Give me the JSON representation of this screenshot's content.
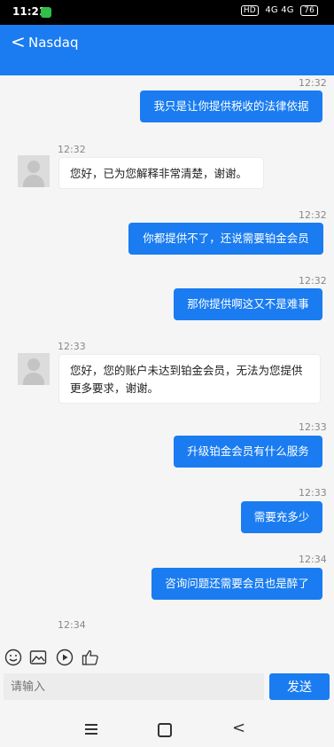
{
  "status_bar": {
    "time": "11:21",
    "indicators": "4G 4G",
    "hd": "HD",
    "battery": "76"
  },
  "header": {
    "back_glyph": "<",
    "title": "Nasdaq"
  },
  "messages": [
    {
      "time": "12:32",
      "text": "我只是让你提供税收的法律依据",
      "side": "out"
    },
    {
      "time": "12:32",
      "text": "您好，已为您解释非常清楚，谢谢。",
      "side": "in"
    },
    {
      "time": "12:32",
      "text": "你都提供不了，还说需要铂金会员",
      "side": "out"
    },
    {
      "time": "12:32",
      "text": "那你提供啊这又不是难事",
      "side": "out"
    },
    {
      "time": "12:33",
      "text": "您好，您的账户未达到铂金会员，无法为您提供更多要求，谢谢。",
      "side": "in"
    },
    {
      "time": "12:33",
      "text": "升级铂金会员有什么服务",
      "side": "out"
    },
    {
      "time": "12:33",
      "text": "需要充多少",
      "side": "out"
    },
    {
      "time": "12:34",
      "text": "咨询问题还需要会员也是醉了",
      "side": "out"
    },
    {
      "time": "12:34",
      "text": "",
      "side": "in"
    }
  ],
  "toolbar": {
    "icons": [
      "emoji-icon",
      "image-icon",
      "video-icon",
      "thumbs-up-icon"
    ]
  },
  "input": {
    "placeholder": "请输入",
    "send_label": "发送"
  },
  "colors": {
    "accent": "#1a7cf0"
  }
}
